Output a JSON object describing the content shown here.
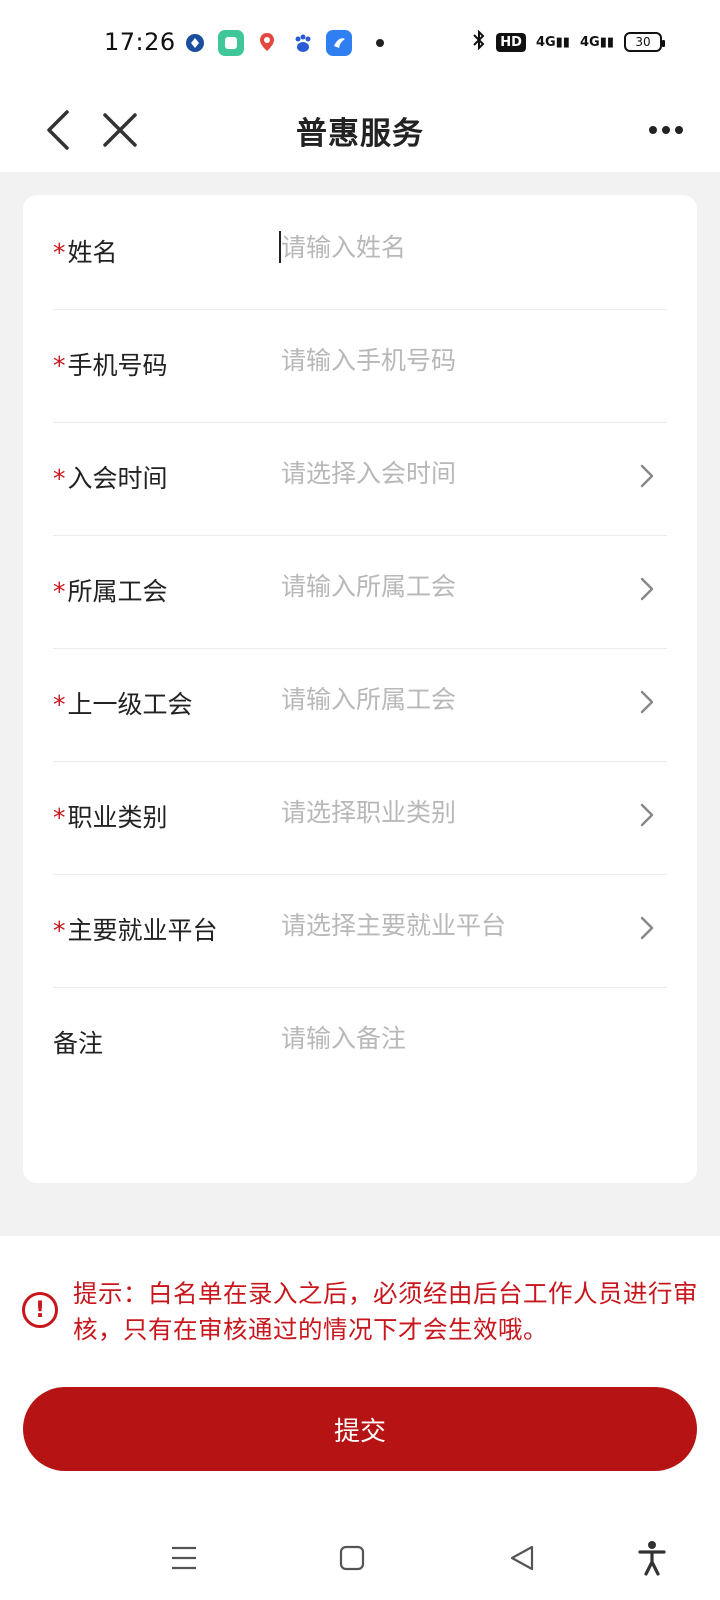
{
  "status_bar": {
    "time": "17:26",
    "app_icons": [
      "bank-app-icon",
      "green-app-icon",
      "map-pin-app-icon",
      "baidu-app-icon",
      "blue-browser-app-icon"
    ],
    "hd_label": "HD",
    "signal_1": "4G",
    "signal_2": "4G",
    "battery_level": "30"
  },
  "nav": {
    "title": "普惠服务"
  },
  "form": {
    "rows": [
      {
        "label": "姓名",
        "required": true,
        "placeholder": "请输入姓名",
        "has_chevron": false
      },
      {
        "label": "手机号码",
        "required": true,
        "placeholder": "请输入手机号码",
        "has_chevron": false
      },
      {
        "label": "入会时间",
        "required": true,
        "placeholder": "请选择入会时间",
        "has_chevron": true
      },
      {
        "label": "所属工会",
        "required": true,
        "placeholder": "请输入所属工会",
        "has_chevron": true
      },
      {
        "label": "上一级工会",
        "required": true,
        "placeholder": "请输入所属工会",
        "has_chevron": true
      },
      {
        "label": "职业类别",
        "required": true,
        "placeholder": "请选择职业类别",
        "has_chevron": true
      },
      {
        "label": "主要就业平台",
        "required": true,
        "placeholder": "请选择主要就业平台",
        "has_chevron": true
      },
      {
        "label": "备注",
        "required": false,
        "placeholder": "请输入备注",
        "has_chevron": false
      }
    ],
    "required_mark": "*"
  },
  "notice": {
    "icon_glyph": "!",
    "text": "提示：白名单在录入之后，必须经由后台工作人员进行审核，只有在审核通过的情况下才会生效哦。"
  },
  "submit": {
    "label": "提交"
  },
  "colors": {
    "accent": "#b61414",
    "required": "#c8161d",
    "placeholder": "#b8b8b8",
    "background": "#f2f2f2"
  }
}
